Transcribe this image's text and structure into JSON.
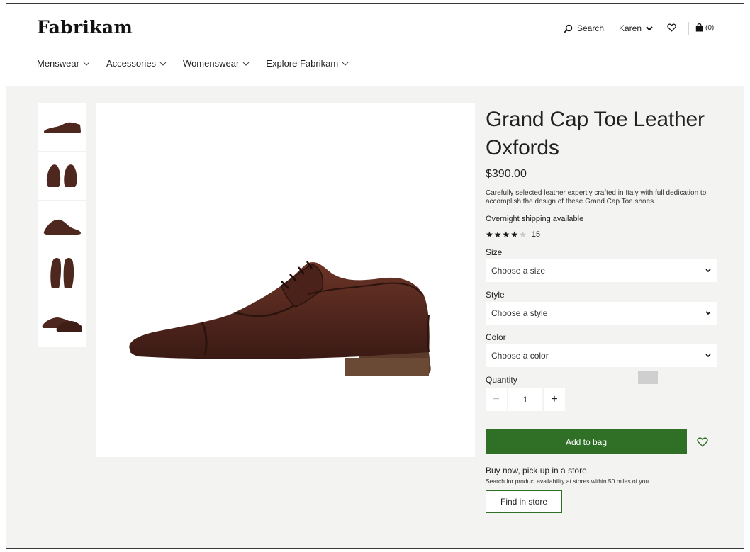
{
  "brand": {
    "logo": "Fabrikam"
  },
  "utility": {
    "search_label": "Search",
    "user_label": "Karen",
    "bag_count": "(0)"
  },
  "nav": {
    "items": [
      {
        "label": "Menswear"
      },
      {
        "label": "Accessories"
      },
      {
        "label": "Womenswear"
      },
      {
        "label": "Explore Fabrikam"
      }
    ]
  },
  "product": {
    "title": "Grand Cap Toe Leather Oxfords",
    "price": "$390.00",
    "description": "Carefully selected leather expertly crafted in Italy with full dedication to accomplish the design of these Grand Cap Toe shoes.",
    "shipping": "Overnight shipping available",
    "rating": {
      "stars": 4,
      "out_of": 5,
      "count": "15"
    }
  },
  "options": {
    "size": {
      "label": "Size",
      "value": "Choose a size"
    },
    "style": {
      "label": "Style",
      "value": "Choose a style"
    },
    "color": {
      "label": "Color",
      "value": "Choose a color"
    }
  },
  "quantity": {
    "label": "Quantity",
    "value": "1",
    "minus": "−",
    "plus": "+"
  },
  "actions": {
    "add_to_bag": "Add to bag"
  },
  "pickup": {
    "title": "Buy now, pick up in a store",
    "subtitle": "Search for product availability at stores within 50 miles of you.",
    "button": "Find in store"
  },
  "colors": {
    "accent": "#2f6f26",
    "leather": "#5a2d22",
    "page_bg": "#f3f3f1"
  }
}
